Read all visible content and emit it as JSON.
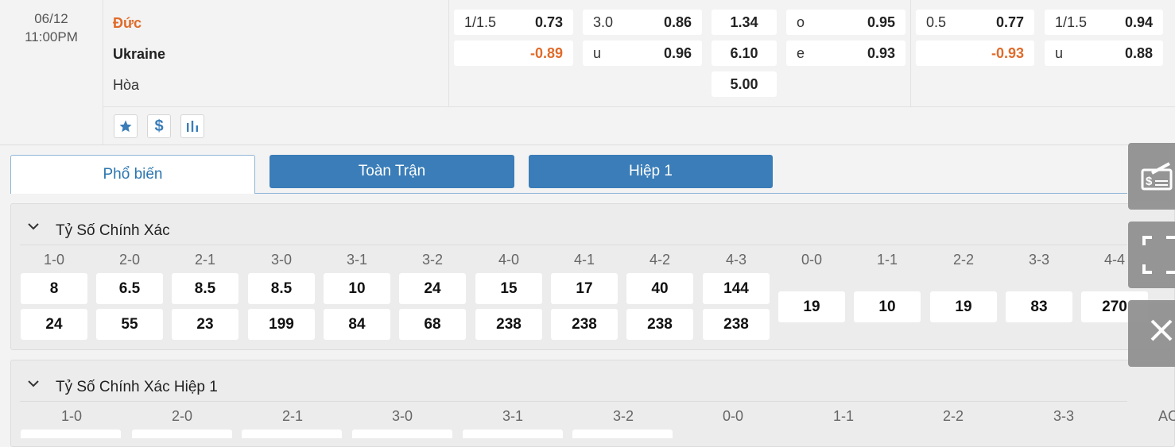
{
  "match": {
    "date": "06/12",
    "time": "11:00PM",
    "home": "Đức",
    "away": "Ukraine",
    "draw": "Hòa",
    "home_color": "#e06b2a"
  },
  "odds": {
    "r1": [
      {
        "label": "1/1.5",
        "value": "0.73"
      },
      {
        "label": "3.0",
        "value": "0.86"
      },
      {
        "value": "1.34"
      },
      {
        "label": "o",
        "value": "0.95"
      },
      {
        "label": "0.5",
        "value": "0.77"
      },
      {
        "label": "1/1.5",
        "value": "0.94"
      }
    ],
    "r2": [
      {
        "value": "-0.89"
      },
      {
        "label": "u",
        "value": "0.96"
      },
      {
        "value": "6.10"
      },
      {
        "label": "e",
        "value": "0.93"
      },
      {
        "value": "-0.93"
      },
      {
        "label": "u",
        "value": "0.88"
      }
    ],
    "draw_value": "5.00"
  },
  "actions": [
    "star-icon",
    "dollar-icon",
    "chart-icon"
  ],
  "tabs": [
    "Phổ biến",
    "Toàn Trận",
    "Hiệp 1"
  ],
  "section1": {
    "title": "Tỷ Số Chính Xác",
    "headers": [
      "1-0",
      "2-0",
      "2-1",
      "3-0",
      "3-1",
      "3-2",
      "4-0",
      "4-1",
      "4-2",
      "4-3",
      "0-0",
      "1-1",
      "2-2",
      "3-3",
      "4-4"
    ],
    "home_row": [
      "8",
      "6.5",
      "8.5",
      "8.5",
      "10",
      "24",
      "15",
      "17",
      "40",
      "144"
    ],
    "away_row": [
      "24",
      "55",
      "23",
      "199",
      "84",
      "68",
      "238",
      "238",
      "238",
      "238"
    ],
    "draw_row": [
      "19",
      "10",
      "19",
      "83",
      "270"
    ]
  },
  "section2": {
    "title": "Tỷ Số Chính Xác Hiệp 1",
    "headers": [
      "1-0",
      "2-0",
      "2-1",
      "3-0",
      "3-1",
      "3-2",
      "0-0",
      "1-1",
      "2-2",
      "3-3",
      "AO"
    ]
  },
  "side_buttons": [
    "bet-slip-icon",
    "expand-icon",
    "close-icon"
  ],
  "colors": {
    "accent": "#3a7db8",
    "negative": "#e06b2a"
  }
}
